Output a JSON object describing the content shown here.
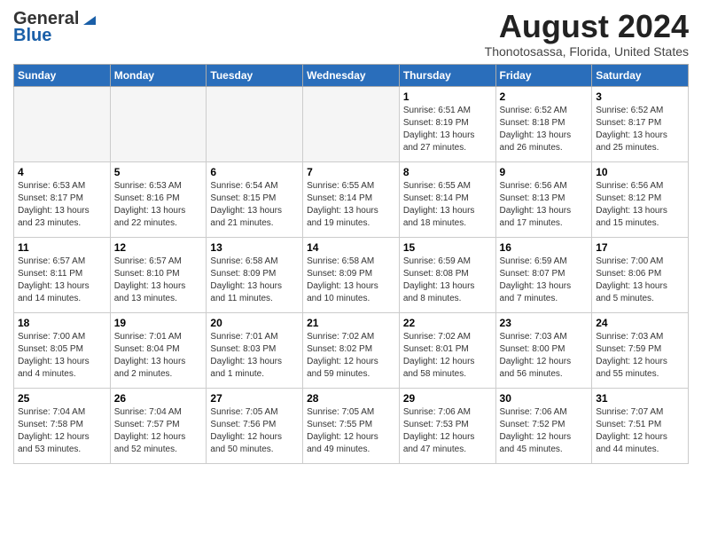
{
  "header": {
    "logo_general": "General",
    "logo_blue": "Blue",
    "month_year": "August 2024",
    "location": "Thonotosassa, Florida, United States"
  },
  "weekdays": [
    "Sunday",
    "Monday",
    "Tuesday",
    "Wednesday",
    "Thursday",
    "Friday",
    "Saturday"
  ],
  "weeks": [
    [
      {
        "day": "",
        "info": ""
      },
      {
        "day": "",
        "info": ""
      },
      {
        "day": "",
        "info": ""
      },
      {
        "day": "",
        "info": ""
      },
      {
        "day": "1",
        "info": "Sunrise: 6:51 AM\nSunset: 8:19 PM\nDaylight: 13 hours\nand 27 minutes."
      },
      {
        "day": "2",
        "info": "Sunrise: 6:52 AM\nSunset: 8:18 PM\nDaylight: 13 hours\nand 26 minutes."
      },
      {
        "day": "3",
        "info": "Sunrise: 6:52 AM\nSunset: 8:17 PM\nDaylight: 13 hours\nand 25 minutes."
      }
    ],
    [
      {
        "day": "4",
        "info": "Sunrise: 6:53 AM\nSunset: 8:17 PM\nDaylight: 13 hours\nand 23 minutes."
      },
      {
        "day": "5",
        "info": "Sunrise: 6:53 AM\nSunset: 8:16 PM\nDaylight: 13 hours\nand 22 minutes."
      },
      {
        "day": "6",
        "info": "Sunrise: 6:54 AM\nSunset: 8:15 PM\nDaylight: 13 hours\nand 21 minutes."
      },
      {
        "day": "7",
        "info": "Sunrise: 6:55 AM\nSunset: 8:14 PM\nDaylight: 13 hours\nand 19 minutes."
      },
      {
        "day": "8",
        "info": "Sunrise: 6:55 AM\nSunset: 8:14 PM\nDaylight: 13 hours\nand 18 minutes."
      },
      {
        "day": "9",
        "info": "Sunrise: 6:56 AM\nSunset: 8:13 PM\nDaylight: 13 hours\nand 17 minutes."
      },
      {
        "day": "10",
        "info": "Sunrise: 6:56 AM\nSunset: 8:12 PM\nDaylight: 13 hours\nand 15 minutes."
      }
    ],
    [
      {
        "day": "11",
        "info": "Sunrise: 6:57 AM\nSunset: 8:11 PM\nDaylight: 13 hours\nand 14 minutes."
      },
      {
        "day": "12",
        "info": "Sunrise: 6:57 AM\nSunset: 8:10 PM\nDaylight: 13 hours\nand 13 minutes."
      },
      {
        "day": "13",
        "info": "Sunrise: 6:58 AM\nSunset: 8:09 PM\nDaylight: 13 hours\nand 11 minutes."
      },
      {
        "day": "14",
        "info": "Sunrise: 6:58 AM\nSunset: 8:09 PM\nDaylight: 13 hours\nand 10 minutes."
      },
      {
        "day": "15",
        "info": "Sunrise: 6:59 AM\nSunset: 8:08 PM\nDaylight: 13 hours\nand 8 minutes."
      },
      {
        "day": "16",
        "info": "Sunrise: 6:59 AM\nSunset: 8:07 PM\nDaylight: 13 hours\nand 7 minutes."
      },
      {
        "day": "17",
        "info": "Sunrise: 7:00 AM\nSunset: 8:06 PM\nDaylight: 13 hours\nand 5 minutes."
      }
    ],
    [
      {
        "day": "18",
        "info": "Sunrise: 7:00 AM\nSunset: 8:05 PM\nDaylight: 13 hours\nand 4 minutes."
      },
      {
        "day": "19",
        "info": "Sunrise: 7:01 AM\nSunset: 8:04 PM\nDaylight: 13 hours\nand 2 minutes."
      },
      {
        "day": "20",
        "info": "Sunrise: 7:01 AM\nSunset: 8:03 PM\nDaylight: 13 hours\nand 1 minute."
      },
      {
        "day": "21",
        "info": "Sunrise: 7:02 AM\nSunset: 8:02 PM\nDaylight: 12 hours\nand 59 minutes."
      },
      {
        "day": "22",
        "info": "Sunrise: 7:02 AM\nSunset: 8:01 PM\nDaylight: 12 hours\nand 58 minutes."
      },
      {
        "day": "23",
        "info": "Sunrise: 7:03 AM\nSunset: 8:00 PM\nDaylight: 12 hours\nand 56 minutes."
      },
      {
        "day": "24",
        "info": "Sunrise: 7:03 AM\nSunset: 7:59 PM\nDaylight: 12 hours\nand 55 minutes."
      }
    ],
    [
      {
        "day": "25",
        "info": "Sunrise: 7:04 AM\nSunset: 7:58 PM\nDaylight: 12 hours\nand 53 minutes."
      },
      {
        "day": "26",
        "info": "Sunrise: 7:04 AM\nSunset: 7:57 PM\nDaylight: 12 hours\nand 52 minutes."
      },
      {
        "day": "27",
        "info": "Sunrise: 7:05 AM\nSunset: 7:56 PM\nDaylight: 12 hours\nand 50 minutes."
      },
      {
        "day": "28",
        "info": "Sunrise: 7:05 AM\nSunset: 7:55 PM\nDaylight: 12 hours\nand 49 minutes."
      },
      {
        "day": "29",
        "info": "Sunrise: 7:06 AM\nSunset: 7:53 PM\nDaylight: 12 hours\nand 47 minutes."
      },
      {
        "day": "30",
        "info": "Sunrise: 7:06 AM\nSunset: 7:52 PM\nDaylight: 12 hours\nand 45 minutes."
      },
      {
        "day": "31",
        "info": "Sunrise: 7:07 AM\nSunset: 7:51 PM\nDaylight: 12 hours\nand 44 minutes."
      }
    ]
  ]
}
